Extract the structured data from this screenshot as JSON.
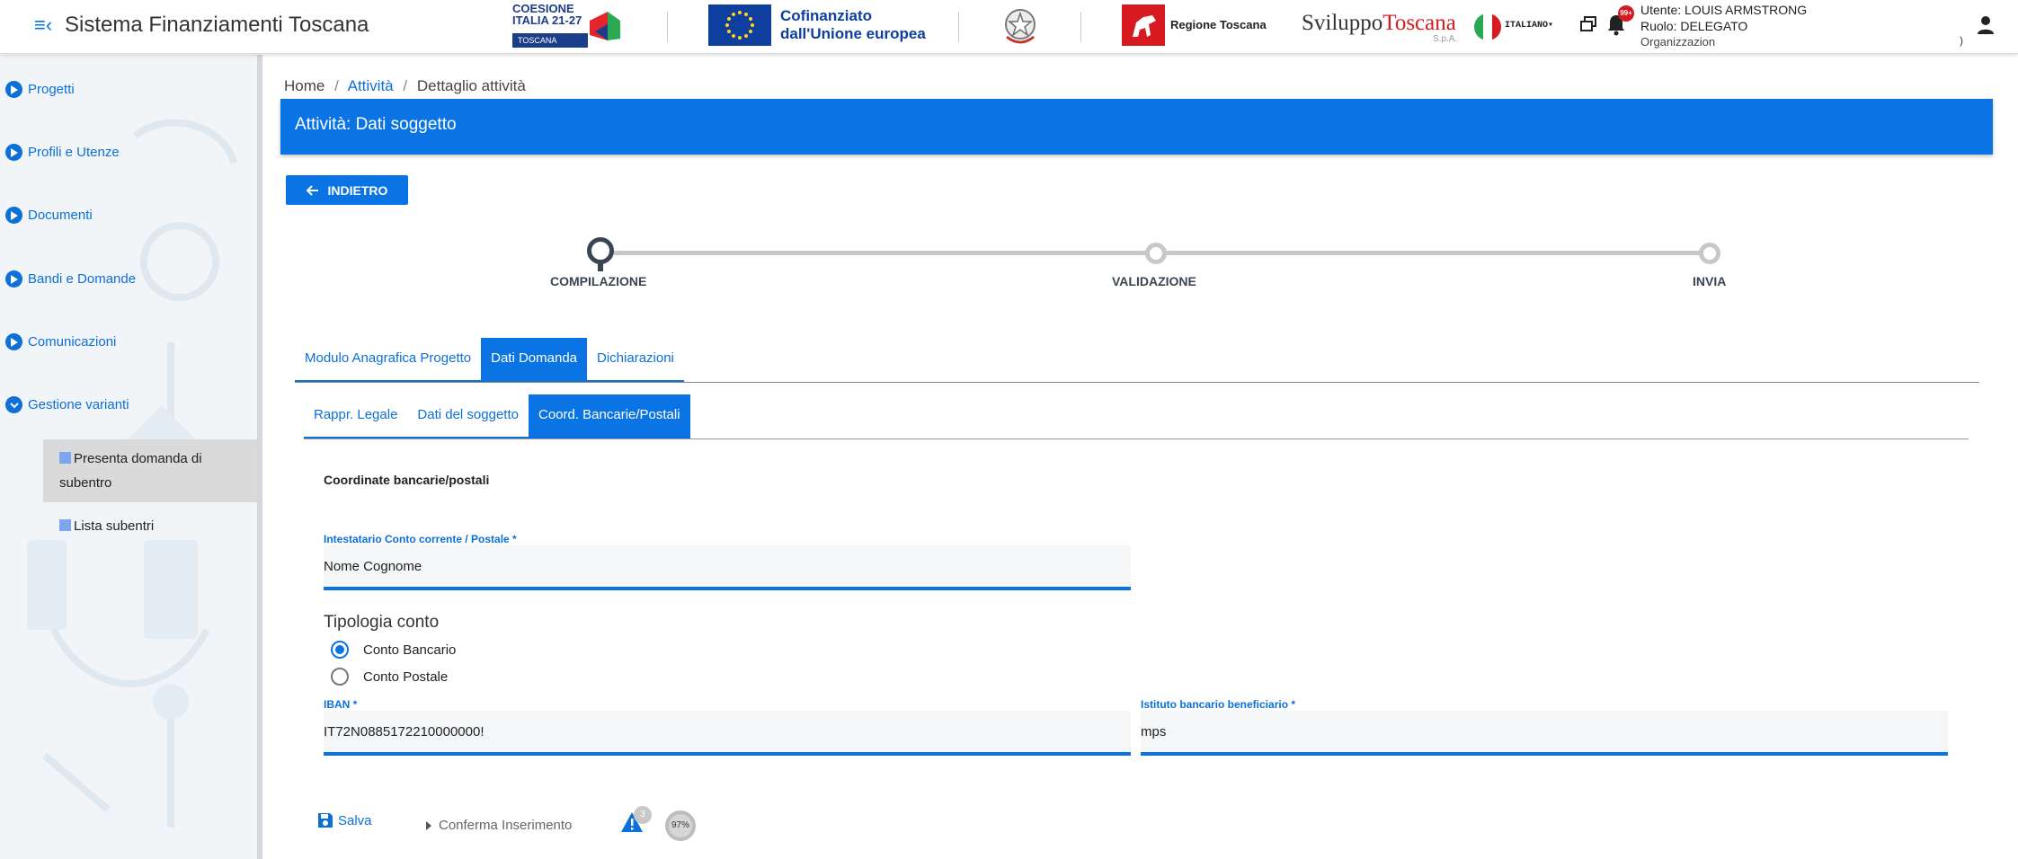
{
  "header": {
    "app_title": "Sistema Finanziamenti Toscana",
    "coesione_line1": "COESIONE",
    "coesione_line2": "ITALIA 21-27",
    "coesione_tag": "TOSCANA",
    "eu_line1": "Cofinanziato",
    "eu_line2": "dall'Unione europea",
    "regione": "Regione Toscana",
    "sviluppo_a": "Sviluppo",
    "sviluppo_b": "Toscana",
    "sviluppo_sub": "S.p.A.",
    "language": "ITALIANO",
    "notification_count": "99+",
    "user_line": "Utente: LOUIS ARMSTRONG",
    "role_line": "Ruolo: DELEGATO",
    "org_line": "Organizzazion",
    "paren": ")"
  },
  "sidebar": {
    "items": [
      {
        "label": "Progetti"
      },
      {
        "label": "Profili e Utenze"
      },
      {
        "label": "Documenti"
      },
      {
        "label": "Bandi e Domande"
      },
      {
        "label": "Comunicazioni"
      },
      {
        "label": "Gestione varianti"
      }
    ],
    "sub_items": [
      {
        "label": "Presenta domanda di subentro"
      },
      {
        "label": "Lista subentri"
      }
    ]
  },
  "breadcrumb": {
    "home": "Home",
    "attivita": "Attività",
    "current": "Dettaglio attività",
    "sep": "/"
  },
  "page_header": {
    "title": "Attività: Dati soggetto"
  },
  "back_button": {
    "label": "INDIETRO"
  },
  "stepper": {
    "steps": [
      "COMPILAZIONE",
      "VALIDAZIONE",
      "INVIA"
    ],
    "current": 0
  },
  "tabs_main": [
    "Modulo Anagrafica Progetto",
    "Dati Domanda",
    "Dichiarazioni"
  ],
  "tabs_sub": [
    "Rappr. Legale",
    "Dati del soggetto",
    "Coord. Bancarie/Postali"
  ],
  "form": {
    "section_title": "Coordinate bancarie/postali",
    "holder_label": "Intestatario Conto corrente / Postale *",
    "holder_value": "Nome Cognome",
    "account_type_title": "Tipologia conto",
    "radio_bank": "Conto Bancario",
    "radio_postal": "Conto Postale",
    "iban_label": "IBAN *",
    "iban_value": "IT72N0885172210000000!",
    "bank_label": "Istituto bancario beneficiario *",
    "bank_value": "mps"
  },
  "footer": {
    "save": "Salva",
    "confirm": "Conferma Inserimento",
    "warning_count": "3",
    "progress": "97%"
  },
  "colors": {
    "primary": "#0b74e5",
    "alert": "#d71920",
    "dark": "#3a4553"
  }
}
